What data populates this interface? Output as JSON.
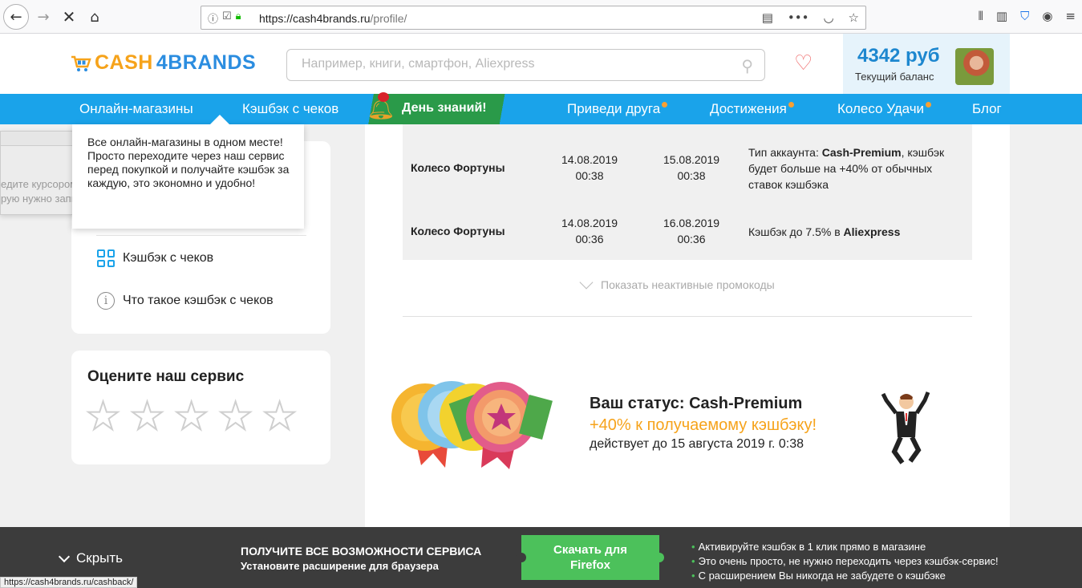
{
  "browser": {
    "url_host": "https://cash4brands.ru",
    "url_path": "/profile/"
  },
  "header": {
    "logo_part1": "CASH",
    "logo_part2": "4BRANDS",
    "search_placeholder": "Например, книги, смартфон, Aliexpress",
    "balance_amount": "4342 руб",
    "balance_label": "Текущий баланс"
  },
  "nav": {
    "items": [
      {
        "label": "Онлайн-магазины"
      },
      {
        "label": "Кэшбэк с чеков"
      },
      {
        "label": "День знаний!"
      },
      {
        "label": "Приведи друга"
      },
      {
        "label": "Достижения"
      },
      {
        "label": "Колесо Удачи"
      },
      {
        "label": "Блог"
      }
    ]
  },
  "tooltip": {
    "text": "Все онлайн-магазины в одном месте!\nПросто переходите через наш сервис перед покупкой и получайте кэшбэк за каждую, это экономно и удобно!"
  },
  "ghost": {
    "line1": "едите курсором",
    "line2": "рую нужно запис"
  },
  "sidebar": {
    "links": [
      {
        "label": "Кэшбэк с чеков",
        "icon": "qr-icon"
      },
      {
        "label": "Что такое кэшбэк с чеков",
        "icon": "info-icon"
      }
    ],
    "rate_title": "Оцените наш сервис",
    "rating": 0,
    "rating_max": 5
  },
  "promos": {
    "rows": [
      {
        "name": "Колесо Фортуны",
        "start_date": "14.08.2019",
        "start_time": "00:38",
        "end_date": "15.08.2019",
        "end_time": "00:38",
        "desc_pre": "Тип аккаунта: ",
        "desc_bold": "Cash-Premium",
        "desc_post": ", кэшбэк будет больше на +40% от обычных ставок кэшбэка"
      },
      {
        "name": "Колесо Фортуны",
        "start_date": "14.08.2019",
        "start_time": "00:36",
        "end_date": "16.08.2019",
        "end_time": "00:36",
        "desc_pre": "Кэшбэк до 7.5% в ",
        "desc_bold": "Aliexpress",
        "desc_post": ""
      }
    ],
    "show_inactive": "Показать неактивные промокоды"
  },
  "status": {
    "line1": "Ваш статус: Cash-Premium",
    "line2": "+40% к получаемому кэшбэку!",
    "line3": "действует до 15 августа 2019 г. 0:38"
  },
  "footer": {
    "hide_label": "Скрыть",
    "promo_title": "ПОЛУЧИТЕ ВСЕ ВОЗМОЖНОСТИ СЕРВИСА",
    "promo_sub": "Установите расширение для браузера",
    "button_line1": "Скачать для",
    "button_line2": "Firefox",
    "benefits": [
      "Активируйте кэшбэк в 1 клик прямо в магазине",
      "Это очень просто, не нужно переходить через кэшбэк-сервис!",
      "С расширением Вы никогда не забудете о кэшбэке"
    ]
  },
  "statusbar": {
    "link": "https://cash4brands.ru/cashback/"
  },
  "colors": {
    "brand_blue": "#1aa3ea",
    "brand_orange": "#f6a31b",
    "cta_green": "#4cc15b"
  }
}
